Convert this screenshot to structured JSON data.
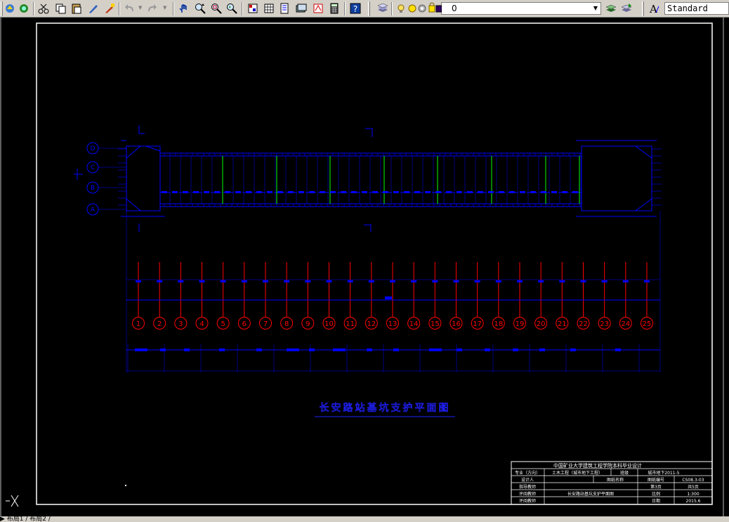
{
  "toolbar": {
    "layer_value": "0",
    "text_style_value": "Standard",
    "icons": [
      "open-icon",
      "publish-icon",
      "cut-icon",
      "copy-icon",
      "paste-icon",
      "brush-icon",
      "match-properties-icon",
      "undo-icon",
      "redo-icon",
      "pan-icon",
      "zoom-realtime-icon",
      "zoom-window-icon",
      "zoom-previous-icon",
      "properties-icon",
      "design-center-icon",
      "tool-palettes-icon",
      "sheet-set-icon",
      "markup-icon",
      "calculator-icon",
      "help-icon",
      "layer-manager-icon",
      "layer-previous-icon",
      "text-style-icon"
    ]
  },
  "drawing": {
    "title": "长安路站基坑支护平面图",
    "axis_row_labels": [
      "D",
      "C",
      "B",
      "A"
    ],
    "axis_column_labels": [
      "1",
      "2",
      "3",
      "4",
      "5",
      "6",
      "7",
      "8",
      "9",
      "10",
      "11",
      "12",
      "13",
      "14",
      "15",
      "16",
      "17",
      "18",
      "19",
      "20",
      "21",
      "22",
      "23",
      "24",
      "25"
    ],
    "colors": {
      "background": "#000000",
      "frame": "#ffffff",
      "structure": "#0000ff",
      "marker": "#ff0000",
      "highlight": "#00ff00",
      "outline": "#2020ff"
    }
  },
  "title_block": {
    "header": "中国矿业大学建筑工程学院本科毕业设计",
    "rows": [
      {
        "c1": "专业（方向）",
        "c2": "土木工程（城市地下工程）",
        "c3": "班级",
        "c4": "城市地下2011-5"
      },
      {
        "c1": "设计人",
        "c2": "",
        "c3": "图纸名称",
        "c4": "图纸编号",
        "c5": "CS08.3-03"
      },
      {
        "c1": "指导教师",
        "c2": "",
        "c3": "",
        "c4": "第3页",
        "c5": "共5页"
      },
      {
        "c1": "评阅教师",
        "c2": "长安路站基坑支护平面图",
        "c3": "",
        "c4": "比例",
        "c5": "1:300"
      },
      {
        "c1": "评阅教师",
        "c2": "",
        "c3": "",
        "c4": "日期",
        "c5": "2015.6"
      }
    ]
  },
  "status": {
    "tabs": "▶ 布局1 / 布局2 /"
  }
}
